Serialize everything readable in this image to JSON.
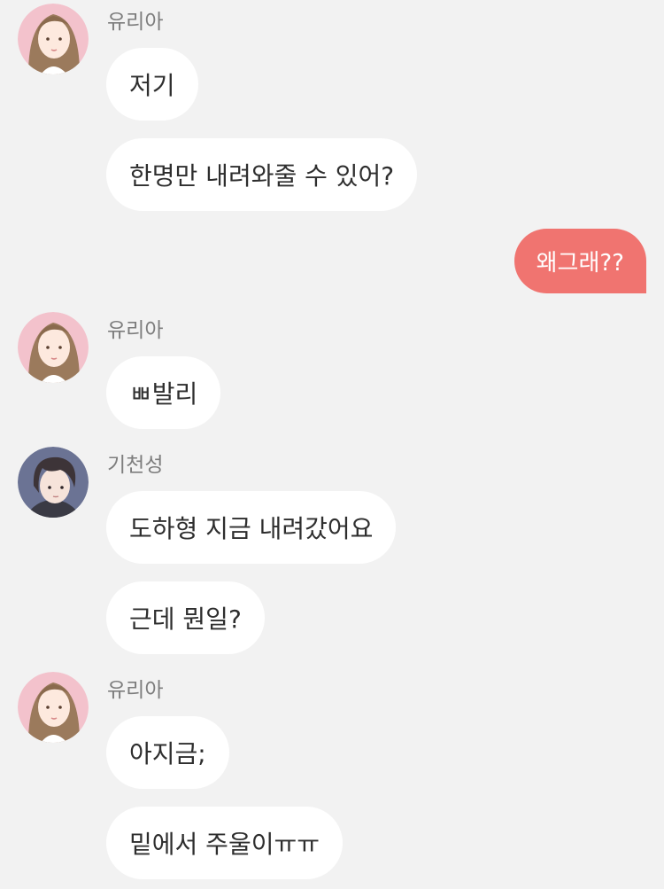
{
  "chat": {
    "messages": [
      {
        "sender": "유리아",
        "bubbles": [
          "저기",
          "한명만 내려와줄 수 있어?"
        ]
      },
      {
        "mine": true,
        "bubbles": [
          "왜그래??"
        ]
      },
      {
        "sender": "유리아",
        "bubbles": [
          "ㅃ발리"
        ]
      },
      {
        "sender": "기천성",
        "bubbles": [
          "도하형 지금 내려갔어요",
          "근데 뭔일?"
        ]
      },
      {
        "sender": "유리아",
        "bubbles": [
          "아지금;",
          "밑에서 주울이ㅠㅠ"
        ]
      }
    ]
  },
  "colors": {
    "background": "#f2f2f2",
    "incoming_bubble": "#ffffff",
    "outgoing_bubble": "#f07470",
    "sender_text": "#7d7d7d"
  }
}
